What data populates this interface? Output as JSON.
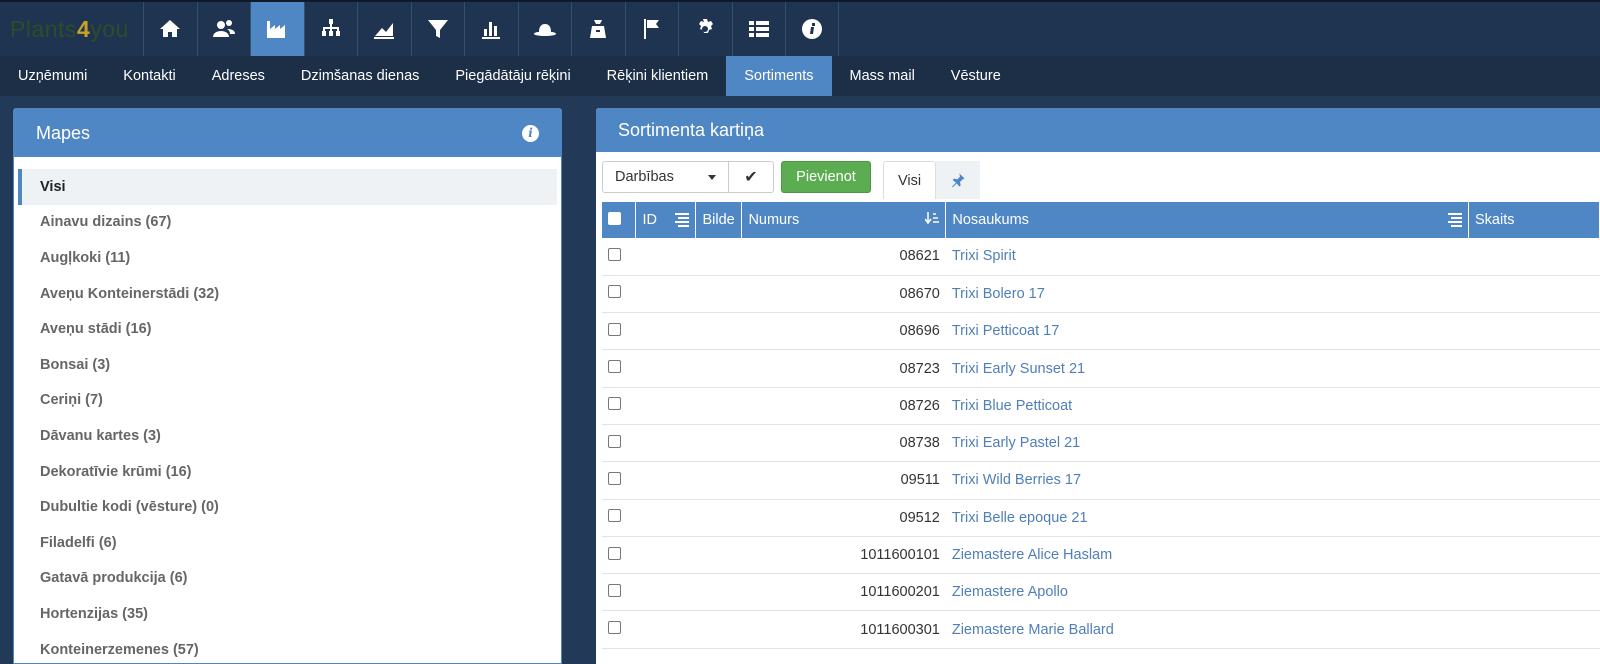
{
  "logo": {
    "left": "Plants",
    "mid": "4",
    "right": "you"
  },
  "top_icons": [
    {
      "name": "home-icon"
    },
    {
      "name": "contacts-icon"
    },
    {
      "name": "factory-icon",
      "active": true
    },
    {
      "name": "sitemap-icon"
    },
    {
      "name": "area-chart-icon"
    },
    {
      "name": "filter-icon"
    },
    {
      "name": "bar-chart-icon"
    },
    {
      "name": "hat-icon"
    },
    {
      "name": "money-bag-icon"
    },
    {
      "name": "flag-icon"
    },
    {
      "name": "gear-icon"
    },
    {
      "name": "list-icon"
    },
    {
      "name": "info-icon"
    }
  ],
  "nav": {
    "items": [
      "Uzņēmumi",
      "Kontakti",
      "Adreses",
      "Dzimšanas dienas",
      "Piegādātāju rēķini",
      "Rēķini klientiem",
      "Sortiments",
      "Mass mail",
      "Vēsture"
    ],
    "active": "Sortiments"
  },
  "left_panel": {
    "title": "Mapes",
    "folders": [
      "Visi",
      "Ainavu dizains (67)",
      "Augļkoki (11)",
      "Aveņu Konteinerstādi (32)",
      "Aveņu stādi (16)",
      "Bonsai (3)",
      "Ceriņi (7)",
      "Dāvanu kartes (3)",
      "Dekoratīvie krūmi (16)",
      "Dubultie kodi (vēsture) (0)",
      "Filadelfi (6)",
      "Gatavā produkcija (6)",
      "Hortenzijas (35)",
      "Konteinerzemenes (57)"
    ]
  },
  "right_panel": {
    "title": "Sortimenta kartiņa",
    "toolbar": {
      "actions_label": "Darbības",
      "add_label": "Pievienot",
      "tab_all": "Visi"
    },
    "columns": {
      "id": "ID",
      "image": "Bilde",
      "number": "Numurs",
      "name": "Nosaukums",
      "count": "Skaits"
    },
    "rows": [
      {
        "number": "08621",
        "name": "Trixi Spirit"
      },
      {
        "number": "08670",
        "name": "Trixi Bolero 17"
      },
      {
        "number": "08696",
        "name": "Trixi Petticoat 17"
      },
      {
        "number": "08723",
        "name": "Trixi Early Sunset 21"
      },
      {
        "number": "08726",
        "name": "Trixi Blue Petticoat"
      },
      {
        "number": "08738",
        "name": "Trixi Early Pastel 21"
      },
      {
        "number": "09511",
        "name": "Trixi Wild Berries 17"
      },
      {
        "number": "09512",
        "name": "Trixi Belle epoque 21"
      },
      {
        "number": "1011600101",
        "name": "Ziemastere Alice Haslam"
      },
      {
        "number": "1011600201",
        "name": "Ziemastere Apollo"
      },
      {
        "number": "1011600301",
        "name": "Ziemastere Marie Ballard"
      }
    ]
  },
  "colors": {
    "accent": "#4f86c4",
    "topbar": "#1f3450",
    "navbar": "#1c2f47",
    "add_button": "#5cad52"
  }
}
